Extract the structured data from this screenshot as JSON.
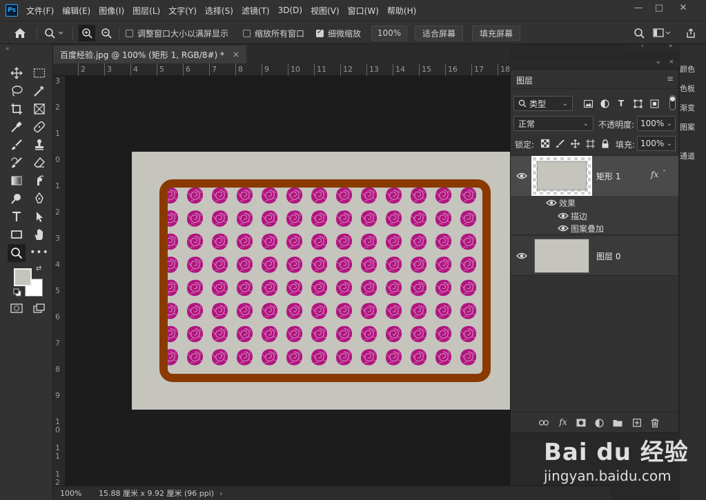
{
  "menu": {
    "logo": "Ps",
    "items": [
      "文件(F)",
      "编辑(E)",
      "图像(I)",
      "图层(L)",
      "文字(Y)",
      "选择(S)",
      "滤镜(T)",
      "3D(D)",
      "视图(V)",
      "窗口(W)",
      "帮助(H)"
    ]
  },
  "window_controls": {
    "minimize": "—",
    "restore": "□",
    "close": "✕"
  },
  "options": {
    "resize_windows": "调整窗口大小以满屏显示",
    "zoom_all": "缩放所有窗口",
    "scrubby_zoom": "细微缩放",
    "zoom_value": "100%",
    "fit_screen": "适合屏幕",
    "fill_screen": "填充屏幕"
  },
  "document": {
    "tab_title": "百度经验.jpg @ 100% (矩形 1, RGB/8#) *",
    "close": "×",
    "colors": {
      "background": "#c5c5be",
      "stroke": "#8a3a00",
      "pattern": "#b0157f"
    },
    "pattern_icon": "rose-icon"
  },
  "ruler": {
    "top": [
      "2",
      "3",
      "4",
      "5",
      "6",
      "7",
      "8",
      "9",
      "10",
      "11",
      "12",
      "13",
      "14",
      "15",
      "16",
      "17",
      "18"
    ],
    "left": [
      "3",
      "2",
      "1",
      "0",
      "1",
      "2",
      "3",
      "4",
      "5",
      "6",
      "7",
      "8",
      "9",
      "1\n0",
      "1\n1",
      "1\n2"
    ]
  },
  "status": {
    "zoom": "100%",
    "size": "15.88 厘米 x 9.92 厘米 (96 ppi)"
  },
  "layers_panel": {
    "title": "图层",
    "filter": "类型",
    "blend_mode": "正常",
    "opacity_label": "不透明度:",
    "opacity": "100%",
    "lock_label": "锁定:",
    "fill_label": "填充:",
    "fill": "100%",
    "layers": [
      {
        "name": "矩形 1",
        "fx": "fx",
        "effects_label": "效果",
        "effects": [
          "描边",
          "图案叠加"
        ]
      },
      {
        "name": "图层 0"
      }
    ]
  },
  "right_dock": [
    "颜色",
    "色板",
    "渐变",
    "图案",
    "通道"
  ],
  "watermark": {
    "brand": "Bai du 经验",
    "url": "jingyan.baidu.com"
  }
}
